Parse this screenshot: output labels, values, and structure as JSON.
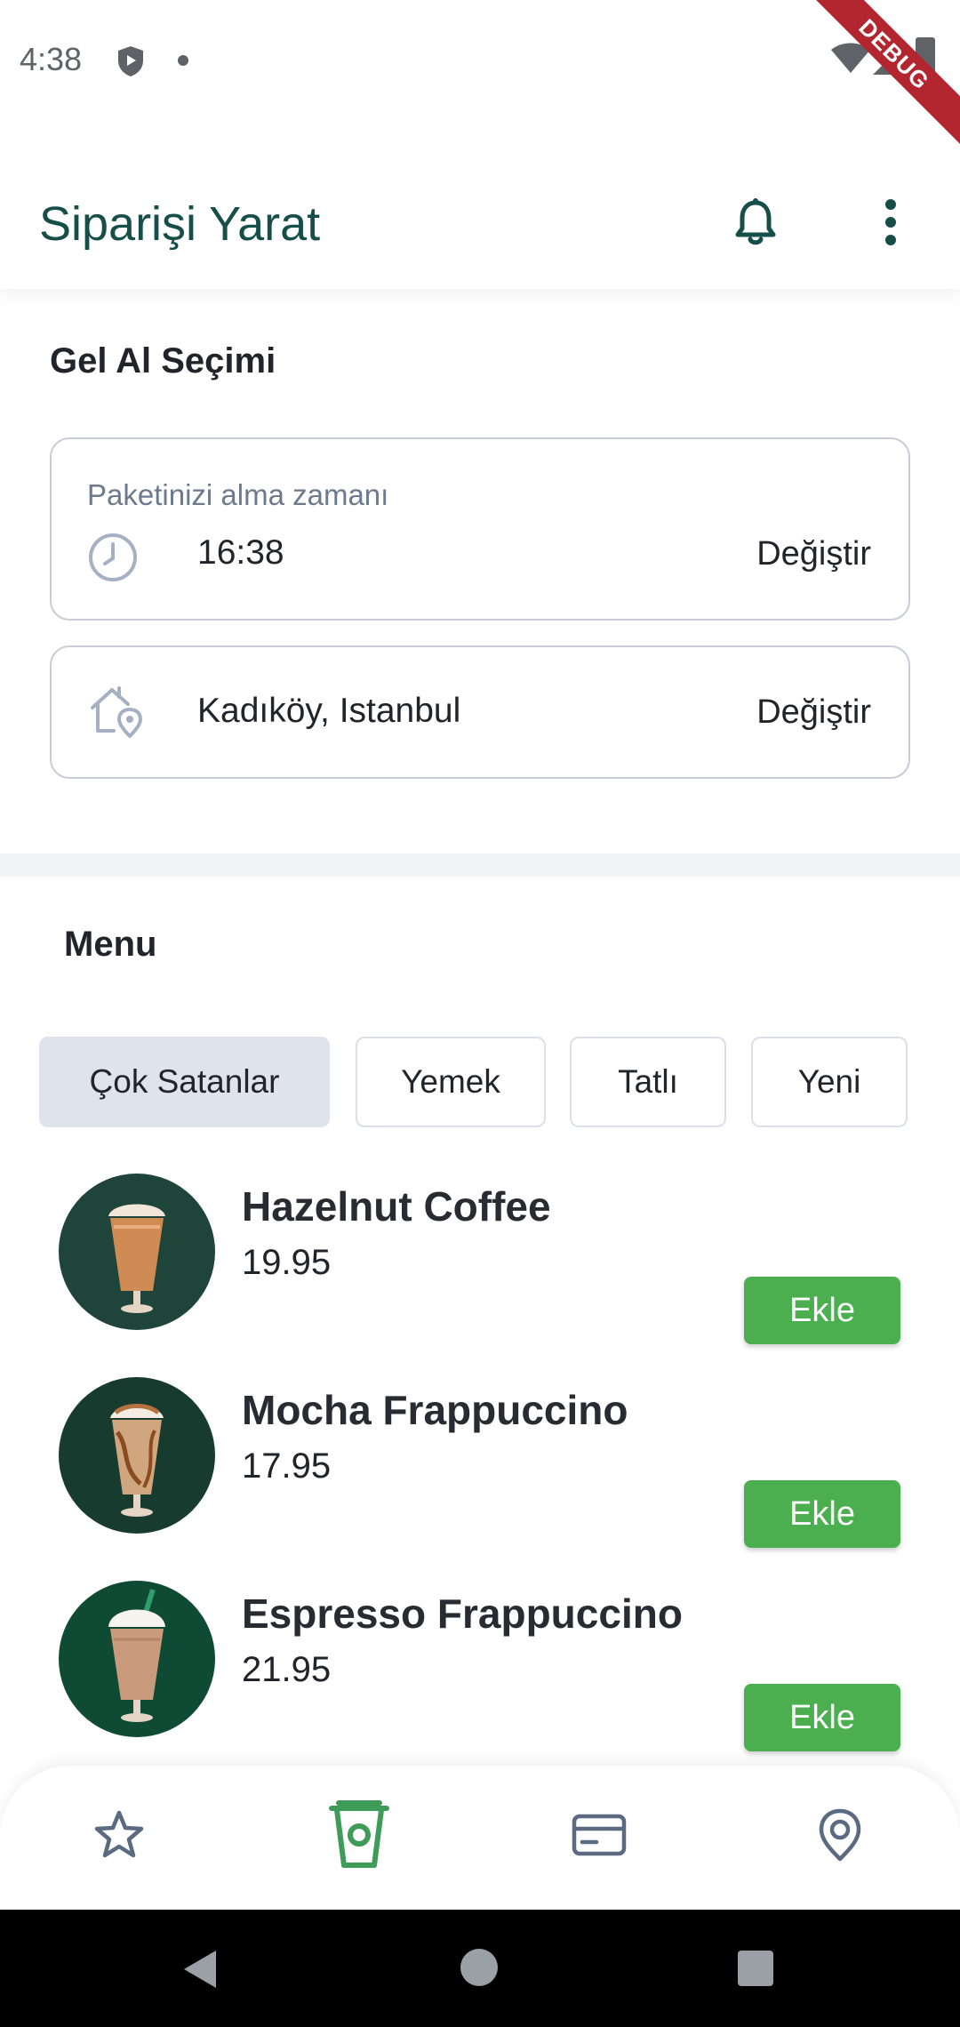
{
  "status_bar": {
    "time": "4:38",
    "debug_label": "DEBUG"
  },
  "app_bar": {
    "title": "Siparişi Yarat",
    "bell_icon": "bell-icon",
    "more_icon": "more-vertical-icon"
  },
  "pickup": {
    "title": "Gel Al Seçimi",
    "time_card": {
      "label": "Paketinizi alma zamanı",
      "value": "16:38",
      "change": "Değiştir",
      "icon": "clock-icon"
    },
    "location_card": {
      "value": "Kadıköy, Istanbul",
      "change": "Değiştir",
      "icon": "home-location-icon"
    }
  },
  "menu": {
    "title": "Menu",
    "tabs": [
      {
        "label": "Çok Satanlar",
        "active": true
      },
      {
        "label": "Yemek",
        "active": false
      },
      {
        "label": "Tatlı",
        "active": false
      },
      {
        "label": "Yeni",
        "active": false
      }
    ],
    "products": [
      {
        "name": "Hazelnut Coffee",
        "price": "19.95",
        "button": "Ekle"
      },
      {
        "name": "Mocha Frappuccino",
        "price": "17.95",
        "button": "Ekle"
      },
      {
        "name": "Espresso Frappuccino",
        "price": "21.95",
        "button": "Ekle"
      }
    ]
  },
  "bottom_nav": {
    "items": [
      {
        "icon": "star-icon",
        "active": false
      },
      {
        "icon": "cup-icon",
        "active": true
      },
      {
        "icon": "card-icon",
        "active": false
      },
      {
        "icon": "location-pin-icon",
        "active": false
      }
    ]
  },
  "colors": {
    "primary": "#164e4a",
    "accent_green": "#4bae4f",
    "nav_active": "#3f9c58",
    "nav_inactive": "#5a6a80"
  }
}
